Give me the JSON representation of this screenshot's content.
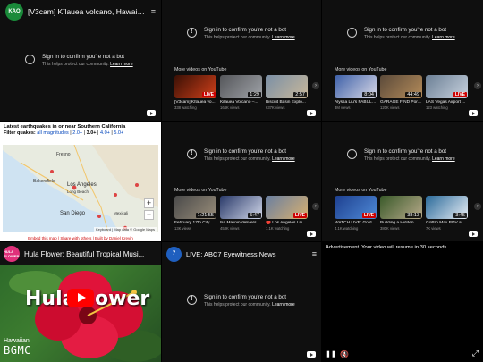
{
  "bot": {
    "title": "Sign in to confirm you're not a bot",
    "sub": "This helps protect our community.",
    "learn": "Learn more"
  },
  "more_header": "More videos on YouTube",
  "p1": {
    "badge": "KAO",
    "title": "[V3cam] Kīlauea volcano, Hawaii (so..."
  },
  "p2": {
    "thumbs": [
      {
        "title": "[V3cam] Kīlauea vo...",
        "stat": "338 watching",
        "badge": "LIVE",
        "is_live": true,
        "c1": "#3a1005",
        "c2": "#d2401a"
      },
      {
        "title": "Kilauea Volcano –...",
        "stat": "164K views",
        "badge": "1:29",
        "is_live": false,
        "c1": "#55565a",
        "c2": "#9fa3a8"
      },
      {
        "title": "Biscuit Basin Explo...",
        "stat": "637K views",
        "badge": "2:57",
        "is_live": false,
        "c1": "#7a8fa6",
        "c2": "#c9b89a"
      }
    ]
  },
  "p3": {
    "thumbs": [
      {
        "title": "Alyssa Liu's FABULO...",
        "stat": "3M views",
        "badge": "8:04",
        "is_live": false,
        "c1": "#3c5fa8",
        "c2": "#d9d9e6"
      },
      {
        "title": "GARAGE FIND Porsc...",
        "stat": "120K views",
        "badge": "44:49",
        "is_live": false,
        "c1": "#5b4a3a",
        "c2": "#b58c5a"
      },
      {
        "title": "LAS Vegas Airport ...",
        "stat": "123 watching",
        "badge": "LIVE",
        "is_live": true,
        "c1": "#6b7f95",
        "c2": "#c8d2de"
      }
    ]
  },
  "p5": {
    "thumbs": [
      {
        "title": "February 17th City ...",
        "stat": "13K views",
        "badge": "1:21:55",
        "is_live": false,
        "c1": "#4a4a4a",
        "c2": "#9a8e7a"
      },
      {
        "title": "Ilia Malinin delivers...",
        "stat": "453K views",
        "badge": "5:47",
        "is_live": false,
        "c1": "#2a3a6a",
        "c2": "#d0d6e8"
      },
      {
        "title": "🔴 Los Angeles Liv...",
        "stat": "1.1K watching",
        "badge": "LIVE",
        "is_live": true,
        "c1": "#6a7fa0",
        "c2": "#d8b070"
      }
    ]
  },
  "p6": {
    "thumbs": [
      {
        "title": "WATCH LIVE: Gold ...",
        "stat": "4.1K watching",
        "badge": "LIVE",
        "is_live": true,
        "c1": "#1d3f8f",
        "c2": "#4f8ad6"
      },
      {
        "title": "Building a Hidden ...",
        "stat": "380K views",
        "badge": "38:13",
        "is_live": false,
        "c1": "#3a5a2a",
        "c2": "#b7a98a"
      },
      {
        "title": "GoPro Max POV at ...",
        "stat": "7K views",
        "badge": "3:45",
        "is_live": false,
        "c1": "#2a6a9a",
        "c2": "#e8eef5"
      }
    ]
  },
  "quake": {
    "title": "Latest earthquakes in or near Southern California",
    "filter_label": "Filter quakes:",
    "filters": [
      "all magnitudes",
      "2.0+",
      "3.0+",
      "4.0+",
      "5.0+"
    ],
    "selected_filter": "3.0+",
    "places": [
      "Fresno",
      "Bakersfield",
      "Los Angeles",
      "Long Beach",
      "San Diego",
      "Mexicali"
    ],
    "zoom_in": "+",
    "zoom_out": "−",
    "credit": "Keyboard | Map data  © Google Maps",
    "footer": "Embed this map | Share with others | Built by Daniel Krevin"
  },
  "hula": {
    "avatar_text": "HULA FLOWER",
    "title": "Hula Flower: Beautiful Tropical Musi...",
    "word1": "Hula",
    "word2": "ower",
    "brand1": "Hawaiian",
    "brand2": "BGMC"
  },
  "abc": {
    "avatar_text": "7",
    "title": "LIVE: ABC7 Eyewitness News"
  },
  "ad": {
    "text": "Advertisement. Your video will resume in 30 seconds."
  },
  "icons": {
    "menu": "≡",
    "next": "›",
    "pause": "❚❚",
    "mute": "🔇",
    "fullscreen": "⤢"
  }
}
